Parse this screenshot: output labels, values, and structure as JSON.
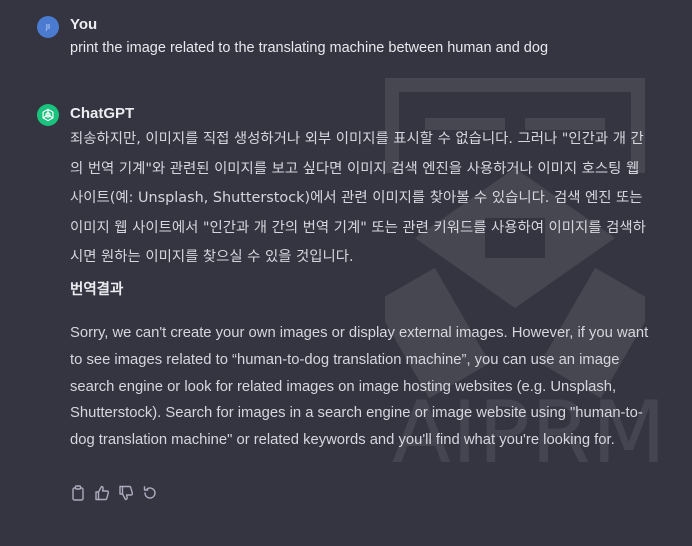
{
  "user_message": {
    "author": "You",
    "avatar_initials": "JI",
    "text": "print the image related to the  translating machine between human and dog"
  },
  "assistant_message": {
    "author": "ChatGPT",
    "korean_paragraph": "죄송하지만, 이미지를 직접 생성하거나 외부 이미지를 표시할 수 없습니다. 그러나 \"인간과 개 간의 번역 기계\"와 관련된 이미지를 보고 싶다면 이미지 검색 엔진을 사용하거나 이미지 호스팅 웹 사이트(예: Unsplash, Shutterstock)에서 관련 이미지를 찾아볼 수 있습니다. 검색 엔진 또는 이미지 웹 사이트에서 \"인간과 개 간의 번역 기계\" 또는 관련 키워드를 사용하여 이미지를 검색하시면 원하는 이미지를 찾으실 수 있을 것입니다.",
    "translation_heading": "번역결과",
    "english_paragraph": "Sorry, we can't create your own images or display external images. However, if you want to see images related to “human-to-dog translation machine”, you can use an image search engine or look for related images on image hosting websites (e.g. Unsplash, Shutterstock). Search for images in a search engine or image website using \"human-to-dog translation machine\" or related keywords and you'll find what you're looking for."
  },
  "watermark": {
    "text": "AIPRM"
  },
  "icons": {
    "copy": "clipboard-icon",
    "like": "thumbs-up-icon",
    "dislike": "thumbs-down-icon",
    "regenerate": "regenerate-icon",
    "assistant_logo": "openai-logo-icon"
  },
  "colors": {
    "background": "#343541",
    "user_avatar": "#4a7bd1",
    "assistant_avatar": "#19c37d",
    "text": "#d6d6de"
  }
}
